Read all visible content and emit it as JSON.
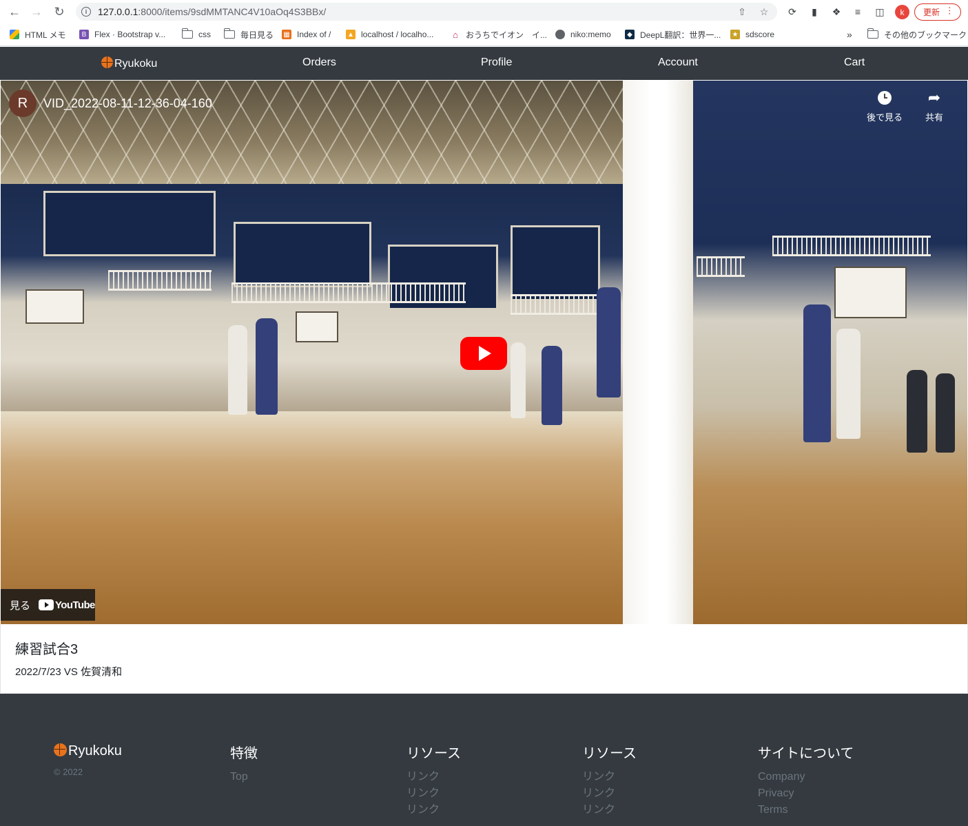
{
  "browser": {
    "url_host": "127.0.0.1",
    "url_path": ":8000/items/9sdMMTANC4V10aOq4S3BBx/",
    "profile_initial": "k",
    "update_label": "更新",
    "bookmarks": [
      {
        "label": "HTML メモ",
        "icon": "google-drive-icon"
      },
      {
        "label": "Flex · Bootstrap v...",
        "icon": "bootstrap-icon"
      },
      {
        "label": "css",
        "icon": "folder-icon"
      },
      {
        "label": "毎日見る",
        "icon": "folder-icon"
      },
      {
        "label": "Index of /",
        "icon": "index-icon"
      },
      {
        "label": "localhost / localho...",
        "icon": "phpmyadmin-icon"
      },
      {
        "label": "おうちでイオン　イ...",
        "icon": "home-icon"
      },
      {
        "label": "niko:memo",
        "icon": "niko-icon"
      },
      {
        "label": "DeepL翻訳：世界一...",
        "icon": "deepl-icon"
      },
      {
        "label": "sdscore",
        "icon": "sdscore-icon"
      }
    ],
    "more_bookmarks_label": "»",
    "other_bookmarks_label": "その他のブックマーク"
  },
  "navbar": {
    "brand": "Ryukoku",
    "items": [
      "Orders",
      "Profile",
      "Account",
      "Cart"
    ]
  },
  "video": {
    "channel_initial": "R",
    "title": "VID_2022-08-11-12-36-04-160",
    "watch_later_label": "後で見る",
    "share_label": "共有",
    "watch_on_label": "見る",
    "youtube_label": "YouTube"
  },
  "item": {
    "title": "練習試合3",
    "description": "2022/7/23 VS 佐賀清和"
  },
  "footer": {
    "brand": "Ryukoku",
    "copyright": "© 2022",
    "columns": [
      {
        "heading": "特徴",
        "links": [
          "Top"
        ]
      },
      {
        "heading": "リソース",
        "links": [
          "リンク",
          "リンク",
          "リンク"
        ]
      },
      {
        "heading": "リソース",
        "links": [
          "リンク",
          "リンク",
          "リンク"
        ]
      },
      {
        "heading": "サイトについて",
        "links": [
          "Company",
          "Privacy",
          "Terms"
        ]
      }
    ]
  },
  "colors": {
    "navbar_bg": "#343a40",
    "youtube_red": "#ff0000",
    "footer_link": "#6c757d",
    "update_red": "#d93025"
  }
}
